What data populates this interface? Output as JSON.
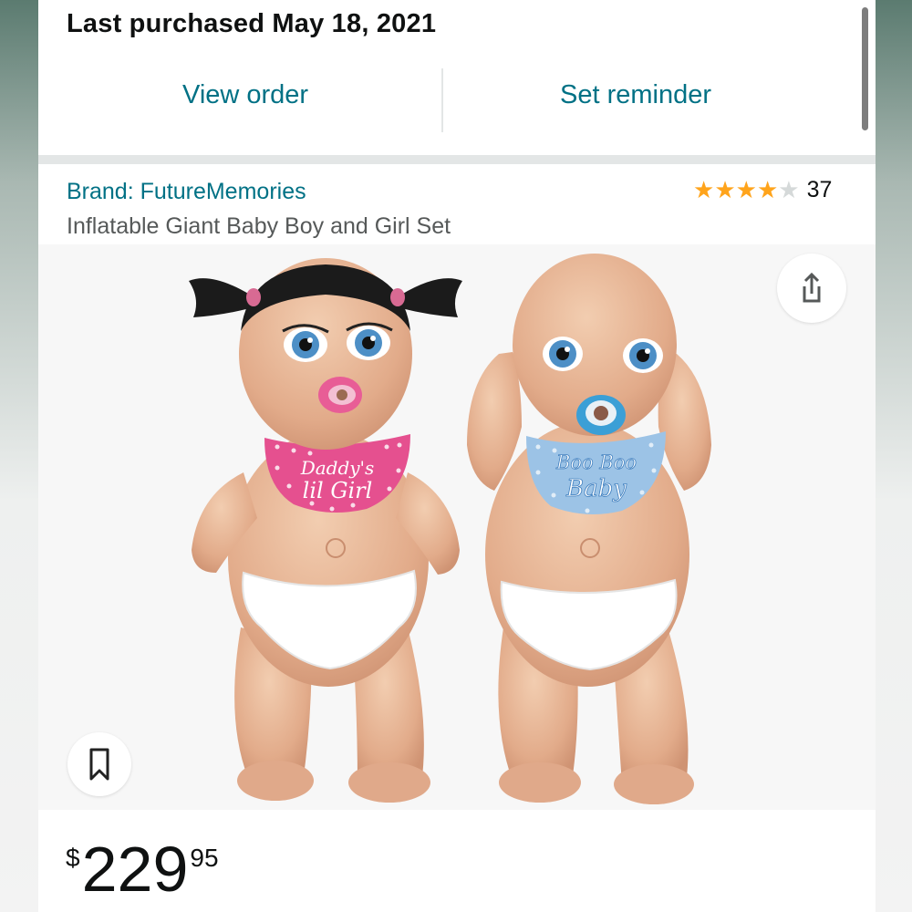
{
  "purchase": {
    "title": "Last purchased May 18, 2021",
    "view_order_label": "View order",
    "set_reminder_label": "Set reminder"
  },
  "product": {
    "brand": "Brand: FutureMemories",
    "title": "Inflatable Giant Baby Boy and Girl Set",
    "rating": {
      "stars": 4,
      "max_stars": 5,
      "count": "37"
    },
    "image": {
      "girl_bib_text": "Daddy's lil Girl",
      "boy_bib_text": "Boo Boo Baby"
    },
    "price": {
      "symbol": "$",
      "whole": "229",
      "fraction": "95"
    }
  },
  "icons": {
    "share": "share-icon",
    "bookmark": "bookmark-icon",
    "star": "star-icon"
  },
  "colors": {
    "link": "#007185",
    "star": "#ffa41c",
    "text": "#0f1111",
    "secondary_text": "#565959"
  }
}
